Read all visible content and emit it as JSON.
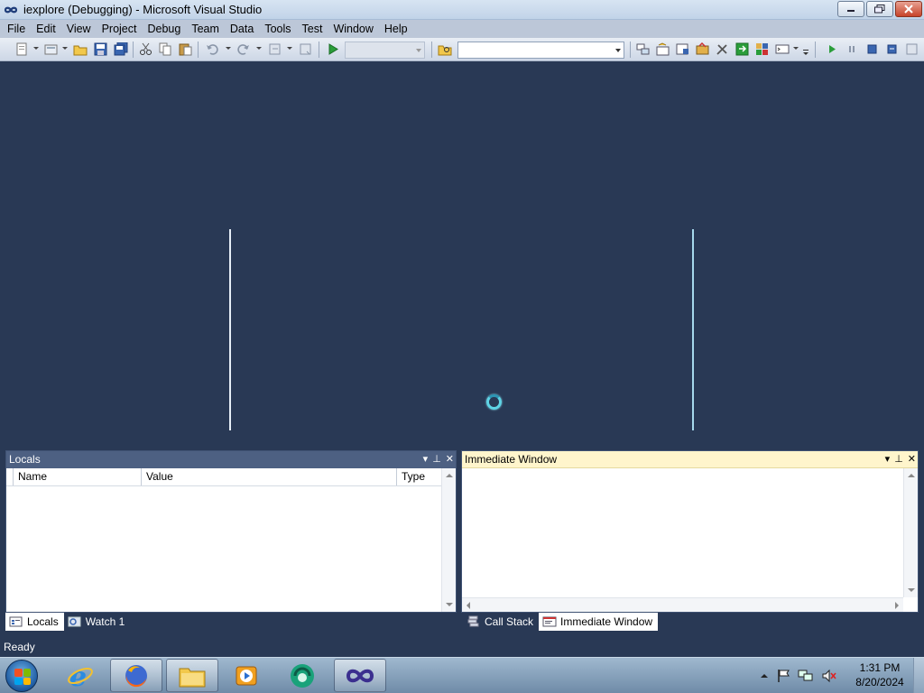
{
  "titlebar": {
    "title": "iexplore (Debugging) - Microsoft Visual Studio",
    "icon": "visual-studio-infinity-icon"
  },
  "menu": [
    "File",
    "Edit",
    "View",
    "Project",
    "Debug",
    "Team",
    "Data",
    "Tools",
    "Test",
    "Window",
    "Help"
  ],
  "toolbar": {
    "solution_config_value": "",
    "find_combo_value": ""
  },
  "locals_panel": {
    "title": "Locals",
    "columns": [
      "Name",
      "Value",
      "Type"
    ]
  },
  "immediate_panel": {
    "title": "Immediate Window"
  },
  "bottom_tabs_left": [
    {
      "label": "Locals",
      "active": true,
      "icon": "locals-icon"
    },
    {
      "label": "Watch 1",
      "active": false,
      "icon": "watch-icon"
    }
  ],
  "bottom_tabs_right": [
    {
      "label": "Call Stack",
      "active": false,
      "icon": "call-stack-icon"
    },
    {
      "label": "Immediate Window",
      "active": true,
      "icon": "immediate-window-icon"
    }
  ],
  "status": {
    "text": "Ready"
  },
  "taskbar": {
    "apps": [
      "internet-explorer-icon",
      "firefox-icon",
      "file-explorer-icon",
      "media-player-icon",
      "cyberlink-icon",
      "visual-studio-icon"
    ],
    "clock_time": "1:31 PM",
    "clock_date": "8/20/2024"
  },
  "colors": {
    "editor_bg": "#293955",
    "panel_header_active": "#fff5cc",
    "panel_header_inactive": "#4d6082"
  }
}
